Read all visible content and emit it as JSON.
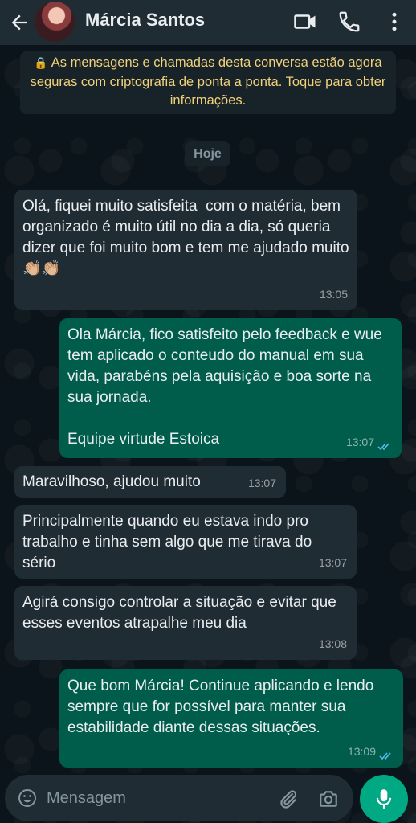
{
  "header": {
    "contact_name": "Márcia Santos",
    "icons": [
      "back-arrow-icon",
      "video-call-icon",
      "voice-call-icon",
      "more-options-icon"
    ]
  },
  "system": {
    "encryption_notice": "As mensagens e chamadas desta conversa estão agora seguras com criptografia de ponta a ponta. Toque para obter informações.",
    "date_label": "Hoje"
  },
  "messages": [
    {
      "direction": "in",
      "text": "Olá, fiquei muito satisfeita  com o matéria, bem organizado é muito útil no dia a dia, só queria dizer que foi muito bom e tem me ajudado muito 👏🏼👏🏼",
      "time": "13:05"
    },
    {
      "direction": "out",
      "text": "Ola Márcia, fico satisfeito pelo feedback e wue tem aplicado o conteudo do manual em sua vida, parabéns pela aquisição e boa sorte na sua jornada.\n\nEquipe virtude Estoica",
      "time": "13:07",
      "status": "read"
    },
    {
      "direction": "in",
      "text": "Maravilhoso, ajudou muito",
      "time": "13:07"
    },
    {
      "direction": "in",
      "text": "Principalmente quando eu estava indo pro trabalho e tinha sem algo que me tirava do sério",
      "time": "13:07"
    },
    {
      "direction": "in",
      "text": "Agirá consigo controlar a situação e evitar que esses eventos atrapalhe meu dia",
      "time": "13:08"
    },
    {
      "direction": "out",
      "text": "Que bom Márcia! Continue aplicando e lendo sempre que for possível para manter sua estabilidade diante dessas situações.",
      "time": "13:09",
      "status": "read"
    }
  ],
  "composer": {
    "placeholder": "Mensagem",
    "icons": [
      "emoji-icon",
      "attach-icon",
      "camera-icon",
      "mic-icon"
    ]
  },
  "colors": {
    "header_bg": "#1f2c34",
    "incoming_bubble": "#202c33",
    "outgoing_bubble": "#005c4b",
    "encryption_text": "#f1d27a",
    "accent": "#00a884",
    "read_ticks": "#53bdeb"
  }
}
